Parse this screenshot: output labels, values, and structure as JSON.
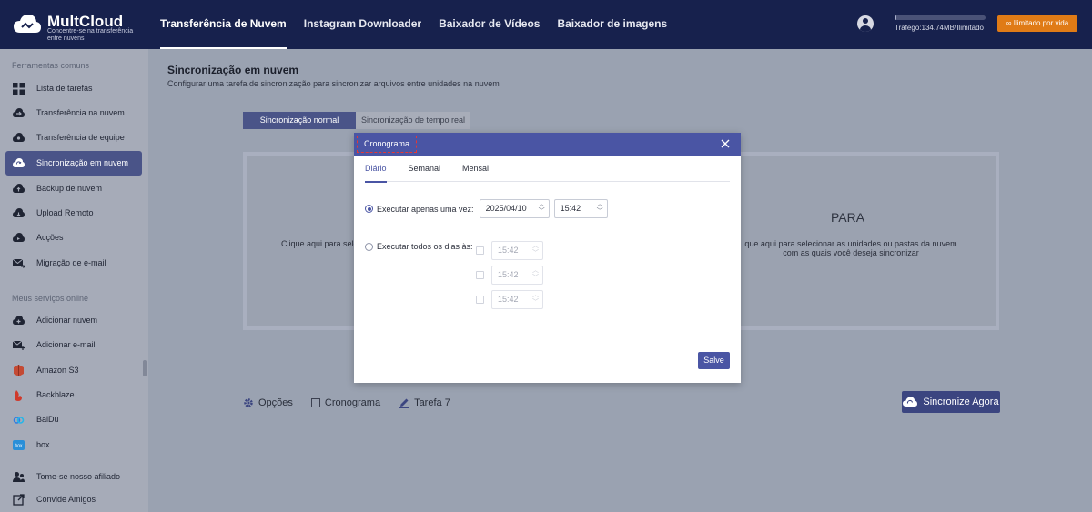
{
  "header": {
    "logo_title": "MultCloud",
    "logo_subtitle": "Concentre-se na transferência entre nuvens",
    "nav": [
      {
        "label": "Transferência de Nuvem",
        "active": true
      },
      {
        "label": "Instagram Downloader",
        "active": false
      },
      {
        "label": "Baixador de Vídeos",
        "active": false
      },
      {
        "label": "Baixador de imagens",
        "active": false
      }
    ],
    "traffic_text": "Tráfego:134.74MB/Ilimitado",
    "traffic_fraction": 0.02,
    "unlimited_button": "Ilimitado por vida",
    "colors": {
      "header_bg": "#17214d",
      "accent_orange": "#e07b16"
    }
  },
  "sidebar": {
    "section1_heading": "Ferramentas comuns",
    "section1_items": [
      {
        "label": "Lista de tarefas",
        "icon": "grid-icon"
      },
      {
        "label": "Transferência na nuvem",
        "icon": "cloud-transfer-icon"
      },
      {
        "label": "Transferência de equipe",
        "icon": "team-transfer-icon"
      },
      {
        "label": "Sincronização em nuvem",
        "icon": "cloud-sync-icon",
        "active": true
      },
      {
        "label": "Backup de nuvem",
        "icon": "cloud-backup-icon"
      },
      {
        "label": "Upload Remoto",
        "icon": "cloud-upload-icon"
      },
      {
        "label": "Acções",
        "icon": "actions-icon"
      },
      {
        "label": "Migração de e-mail",
        "icon": "email-migration-icon"
      }
    ],
    "section2_heading": "Meus serviços online",
    "section2_items": [
      {
        "label": "Adicionar nuvem",
        "icon": "add-cloud-icon"
      },
      {
        "label": "Adicionar e-mail",
        "icon": "add-email-icon"
      },
      {
        "label": "Amazon S3",
        "icon": "amazon-s3-icon"
      },
      {
        "label": "Backblaze",
        "icon": "backblaze-icon"
      },
      {
        "label": "BaiDu",
        "icon": "baidu-icon"
      },
      {
        "label": "box",
        "icon": "box-icon"
      }
    ],
    "footer_items": [
      {
        "label": "Tome-se nosso afiliado",
        "icon": "affiliate-icon"
      },
      {
        "label": "Convide Amigos",
        "icon": "invite-icon"
      }
    ]
  },
  "main": {
    "title": "Sincronização em nuvem",
    "subtitle": "Configurar uma tarefa de sincronização para sincronizar arquivos entre unidades na nuvem",
    "tabs": [
      {
        "label": "Sincronização normal",
        "active": true
      },
      {
        "label": "Sincronização de tempo real",
        "active": false
      }
    ],
    "source_text": "Clique aqui para sele",
    "target_title": "PARA",
    "target_text": "que aqui para selecionar as unidades ou pastas da nuvem com as quais você deseja sincronizar",
    "bottom": {
      "options_label": "Opções",
      "schedule_label": "Cronograma",
      "task_label": "Tarefa 7",
      "sync_now_button": "Sincronize Agora"
    }
  },
  "modal": {
    "title": "Cronograma",
    "tabs": [
      {
        "label": "Diário",
        "active": true
      },
      {
        "label": "Semanal",
        "active": false
      },
      {
        "label": "Mensal",
        "active": false
      }
    ],
    "once_label": "Executar apenas uma vez:",
    "once_date": "2025/04/10",
    "once_time": "15:42",
    "daily_label": "Executar todos os dias às:",
    "daily_times": [
      "15:42",
      "15:42",
      "15:42"
    ],
    "save_button": "Salve"
  }
}
